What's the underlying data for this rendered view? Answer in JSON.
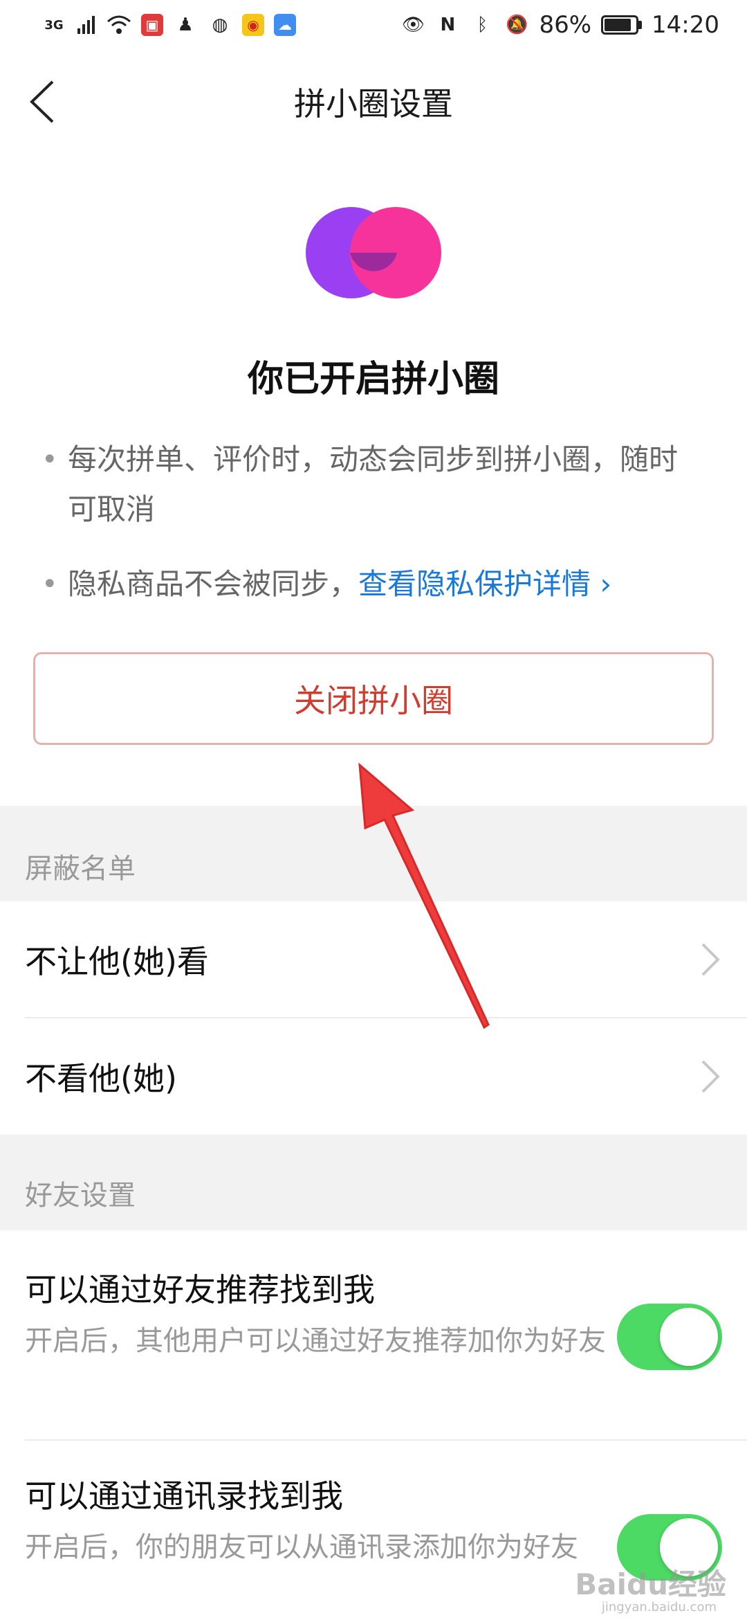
{
  "status_bar": {
    "network": "3G",
    "battery": "86%",
    "battery_level": 0.86,
    "time": "14:20"
  },
  "nav": {
    "title": "拼小圈设置"
  },
  "hero": {
    "title": "你已开启拼小圈"
  },
  "bullets": [
    {
      "text": "每次拼单、评价时，动态会同步到拼小圈，随时可取消"
    },
    {
      "text": "隐私商品不会被同步，",
      "link": "查看隐私保护详情 ›"
    }
  ],
  "close_button": {
    "label": "关闭拼小圈"
  },
  "block_section": {
    "header": "屏蔽名单",
    "items": [
      {
        "label": "不让他(她)看"
      },
      {
        "label": "不看他(她)"
      }
    ]
  },
  "friend_section": {
    "header": "好友设置",
    "items": [
      {
        "title": "可以通过好友推荐找到我",
        "desc": "开启后，其他用户可以通过好友推荐加你为好友",
        "enabled": true
      },
      {
        "title": "可以通过通讯录找到我",
        "desc": "开启后，你的朋友可以从通讯录添加你为好友",
        "enabled": true
      }
    ]
  },
  "colors": {
    "accent_red": "#d23c2d",
    "link_blue": "#1a78d8",
    "toggle_green": "#4cd964",
    "logo_purple": "#9b3ff2",
    "logo_pink": "#f5339a"
  },
  "watermark": {
    "text": "Baidu经验",
    "sub": "jingyan.baidu.com"
  }
}
